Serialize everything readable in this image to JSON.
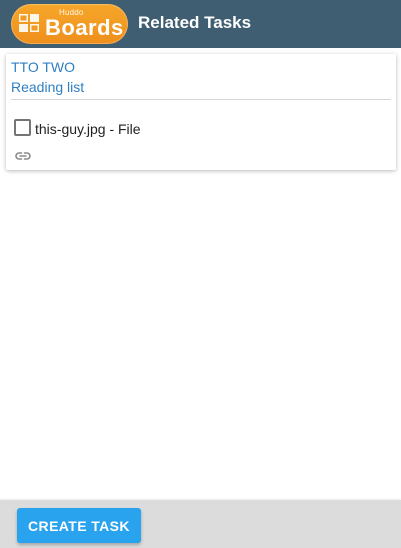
{
  "header": {
    "logo": {
      "small_text": "Huddo",
      "big_text": "Boards",
      "color": "#f39a22"
    },
    "title": "Related Tasks",
    "background_color": "#3f5e72"
  },
  "task_card": {
    "task_name": "TTO TWO",
    "list_name": "Reading list",
    "attachments": [
      {
        "label": "this-guy.jpg - File",
        "checked": false
      }
    ],
    "link_icon": "link-icon",
    "link_color": "#2f7fc3"
  },
  "footer": {
    "create_button_label": "CREATE TASK",
    "button_color": "#29a3ee"
  }
}
